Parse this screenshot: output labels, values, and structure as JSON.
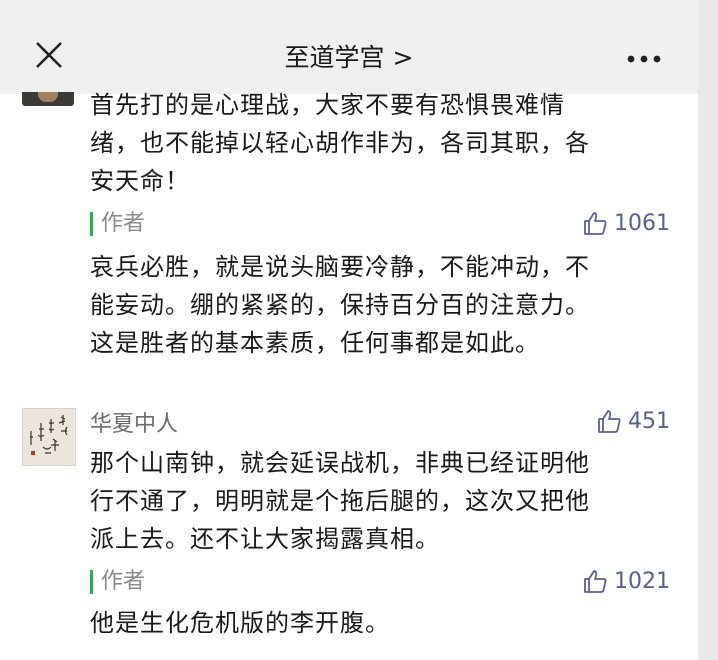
{
  "header": {
    "title": "至道学宫 >"
  },
  "comments": [
    {
      "text_lines": [
        "首先打的是心理战，大家不要有恐惧畏难情",
        "绪，也不能掉以轻心胡作非为，各司其职，各",
        "安天命！"
      ],
      "author_reply": {
        "label": "作者",
        "likes": "1061",
        "text_lines": [
          "哀兵必胜，就是说头脑要冷静，不能冲动，不",
          "能妄动。绷的紧紧的，保持百分百的注意力。",
          "这是胜者的基本素质，任何事都是如此。"
        ]
      }
    },
    {
      "username": "华夏中人",
      "likes": "451",
      "text_lines": [
        "那个山南钟，就会延误战机，非典已经证明他",
        "行不通了，明明就是个拖后腿的，这次又把他",
        "派上去。还不让大家揭露真相。"
      ],
      "author_reply": {
        "label": "作者",
        "likes": "1021",
        "text_lines": [
          "他是生化危机版的李开腹。"
        ]
      }
    }
  ],
  "colors": {
    "header_bg": "#efefef",
    "author_bar": "#3aa455",
    "like_color": "#58628a"
  },
  "icons": [
    "close-icon",
    "more-icon",
    "thumbs-up-icon"
  ]
}
